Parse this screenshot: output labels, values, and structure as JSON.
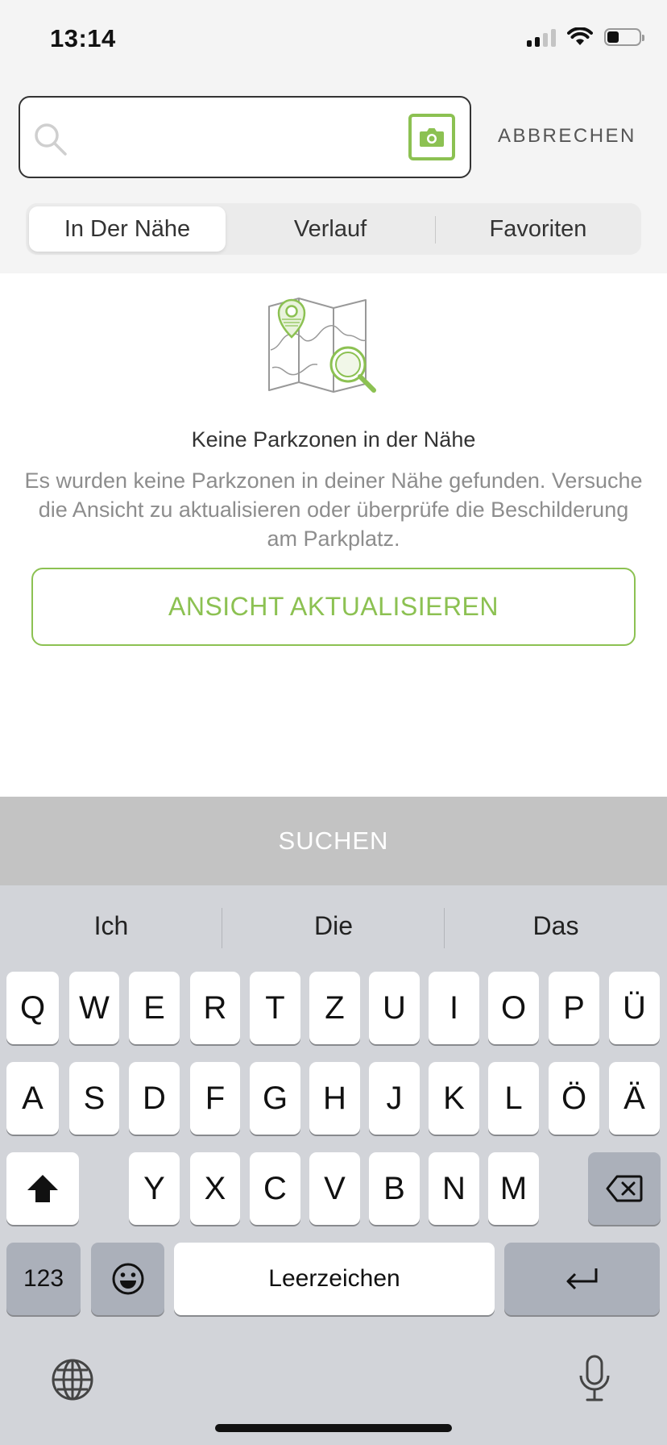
{
  "status_bar": {
    "time": "13:14"
  },
  "search": {
    "query": "",
    "placeholder": "",
    "cancel_label": "ABBRECHEN"
  },
  "tabs": [
    {
      "label": "In Der Nähe",
      "active": true
    },
    {
      "label": "Verlauf",
      "active": false
    },
    {
      "label": "Favoriten",
      "active": false
    }
  ],
  "empty_state": {
    "title": "Keine Parkzonen in der Nähe",
    "text": "Es wurden keine Parkzonen in deiner Nähe gefunden. Versuche die Ansicht zu aktualisieren oder überprüfe die Beschilderung am Parkplatz.",
    "button_label": "ANSICHT AKTUALISIEREN"
  },
  "search_button_label": "SUCHEN",
  "keyboard": {
    "suggestions": [
      "Ich",
      "Die",
      "Das"
    ],
    "row1": [
      "Q",
      "W",
      "E",
      "R",
      "T",
      "Z",
      "U",
      "I",
      "O",
      "P",
      "Ü"
    ],
    "row2": [
      "A",
      "S",
      "D",
      "F",
      "G",
      "H",
      "J",
      "K",
      "L",
      "Ö",
      "Ä"
    ],
    "row3": [
      "Y",
      "X",
      "C",
      "V",
      "B",
      "N",
      "M"
    ],
    "numbers_label": "123",
    "space_label": "Leerzeichen"
  },
  "colors": {
    "accent": "#8cc152",
    "background_top": "#f4f4f4",
    "keyboard_bg": "#d2d4d9",
    "search_bar_bg": "#c3c3c3"
  }
}
